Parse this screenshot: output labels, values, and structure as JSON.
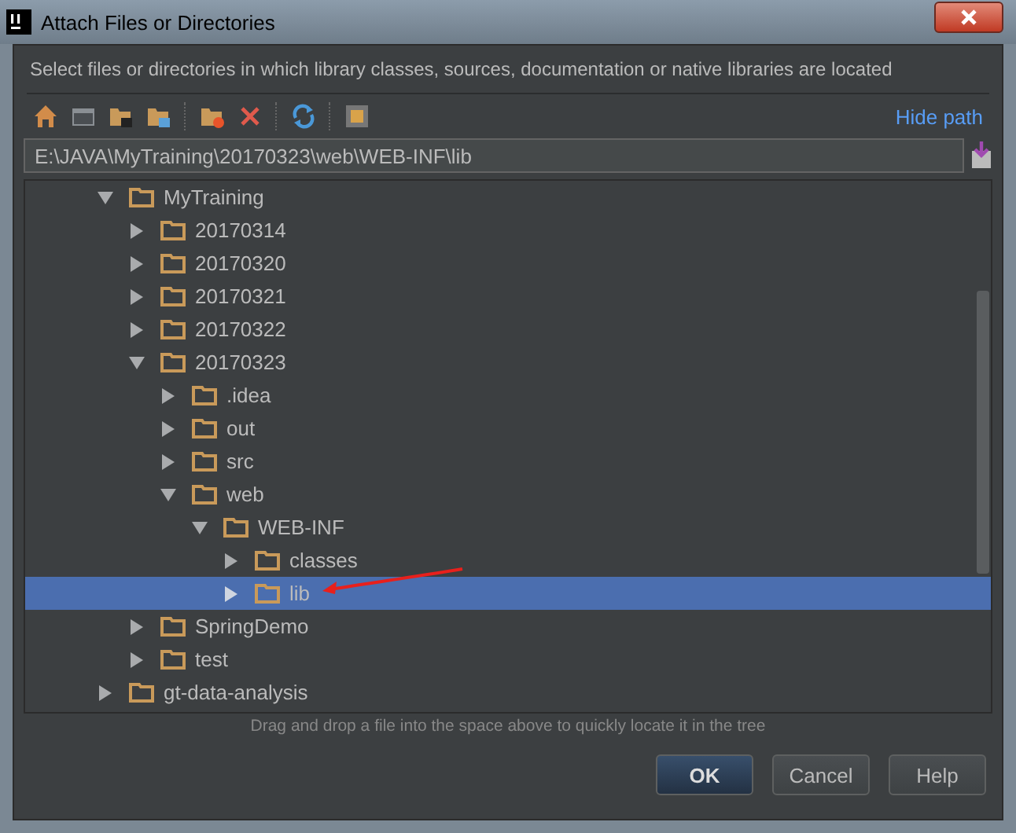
{
  "window": {
    "title": "Attach Files or Directories"
  },
  "description": "Select files or directories in which library classes, sources, documentation or native libraries are located",
  "toolbar": {
    "hide_path_link": "Hide path"
  },
  "path_field": {
    "value": "E:\\JAVA\\MyTraining\\20170323\\web\\WEB-INF\\lib"
  },
  "tree": [
    {
      "label": "MyTraining",
      "expanded": true,
      "selected": false,
      "children": [
        {
          "label": "20170314",
          "expanded": false,
          "selected": false
        },
        {
          "label": "20170320",
          "expanded": false,
          "selected": false
        },
        {
          "label": "20170321",
          "expanded": false,
          "selected": false
        },
        {
          "label": "20170322",
          "expanded": false,
          "selected": false
        },
        {
          "label": "20170323",
          "expanded": true,
          "selected": false,
          "children": [
            {
              "label": ".idea",
              "expanded": false,
              "selected": false
            },
            {
              "label": "out",
              "expanded": false,
              "selected": false
            },
            {
              "label": "src",
              "expanded": false,
              "selected": false
            },
            {
              "label": "web",
              "expanded": true,
              "selected": false,
              "children": [
                {
                  "label": "WEB-INF",
                  "expanded": true,
                  "selected": false,
                  "children": [
                    {
                      "label": "classes",
                      "expanded": false,
                      "selected": false
                    },
                    {
                      "label": "lib",
                      "expanded": false,
                      "selected": true
                    }
                  ]
                }
              ]
            }
          ]
        },
        {
          "label": "SpringDemo",
          "expanded": false,
          "selected": false
        },
        {
          "label": "test",
          "expanded": false,
          "selected": false
        }
      ]
    },
    {
      "label": "gt-data-analysis",
      "expanded": false,
      "selected": false
    }
  ],
  "hint": "Drag and drop a file into the space above to quickly locate it in the tree",
  "buttons": [
    {
      "label": "OK",
      "kind": "primary"
    },
    {
      "label": "Cancel",
      "kind": "normal"
    },
    {
      "label": "Help",
      "kind": "normal"
    }
  ]
}
